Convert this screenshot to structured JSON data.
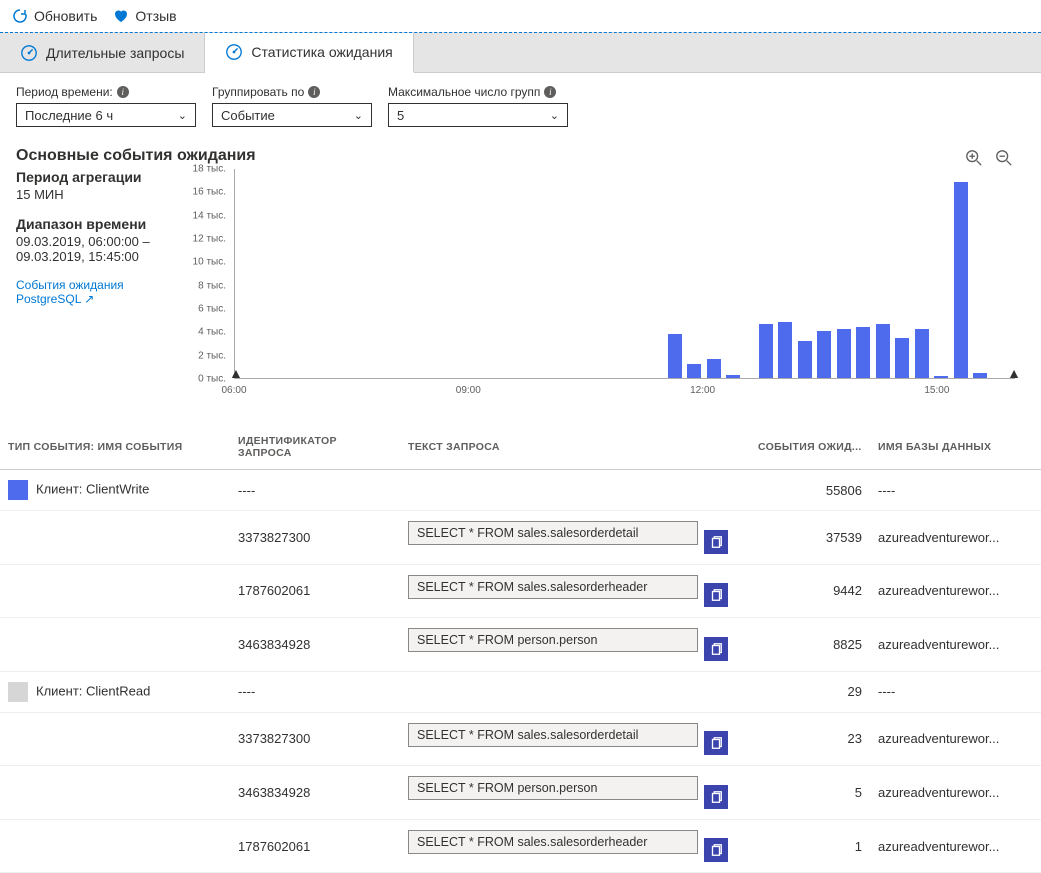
{
  "toolbar": {
    "refresh": "Обновить",
    "feedback": "Отзыв"
  },
  "tabs": {
    "long_queries": "Длительные запросы",
    "wait_stats": "Статистика ожидания"
  },
  "filters": {
    "period_label": "Период времени:",
    "period_value": "Последние 6 ч",
    "group_label": "Группировать по",
    "group_value": "Событие",
    "max_groups_label": "Максимальное число групп",
    "max_groups_value": "5"
  },
  "section_title": "Основные события ожидания",
  "sidebar": {
    "agg_label": "Период агрегации",
    "agg_value": "15 МИН",
    "range_label": "Диапазон времени",
    "range_value": "09.03.2019, 06:00:00 – 09.03.2019, 15:45:00",
    "link": "События ожидания PostgreSQL"
  },
  "chart_data": {
    "type": "bar",
    "ylabel": "тыс.",
    "ylim": [
      0,
      18
    ],
    "y_ticks": [
      0,
      2,
      4,
      6,
      8,
      10,
      12,
      14,
      16,
      18
    ],
    "y_tick_labels": [
      "0 тыс.",
      "2 тыс.",
      "4 тыс.",
      "6 тыс.",
      "8 тыс.",
      "10 тыс.",
      "12 тыс.",
      "14 тыс.",
      "16 тыс.",
      "18 тыс."
    ],
    "x_ticks": [
      "06:00",
      "09:00",
      "12:00",
      "15:00"
    ],
    "x_range_minutes": [
      360,
      960
    ],
    "series": [
      {
        "name": "Клиент: ClientWrite",
        "color": "#4f6bed",
        "points": [
          {
            "t": 693,
            "v": 3.8
          },
          {
            "t": 708,
            "v": 1.2
          },
          {
            "t": 723,
            "v": 1.6
          },
          {
            "t": 738,
            "v": 0.3
          },
          {
            "t": 763,
            "v": 4.6
          },
          {
            "t": 778,
            "v": 4.8
          },
          {
            "t": 793,
            "v": 3.2
          },
          {
            "t": 808,
            "v": 4.0
          },
          {
            "t": 823,
            "v": 4.2
          },
          {
            "t": 838,
            "v": 4.4
          },
          {
            "t": 853,
            "v": 4.6
          },
          {
            "t": 868,
            "v": 3.4
          },
          {
            "t": 883,
            "v": 4.2
          },
          {
            "t": 898,
            "v": 0.2
          },
          {
            "t": 913,
            "v": 16.8
          },
          {
            "t": 928,
            "v": 0.4
          }
        ]
      }
    ]
  },
  "table": {
    "headers": {
      "type": "ТИП СОБЫТИЯ: ИМЯ СОБЫТИЯ",
      "qid": "ИДЕНТИФИКАТОР ЗАПРОСА",
      "qtext": "ТЕКСТ ЗАПРОСА",
      "events": "СОБЫТИЯ ОЖИД...",
      "db": "ИМЯ БАЗЫ ДАННЫХ"
    },
    "groups": [
      {
        "swatch": "sw1",
        "name": "Клиент: ClientWrite",
        "qid": "----",
        "events": 55806,
        "db": "----",
        "rows": [
          {
            "qid": "3373827300",
            "qtext": "SELECT * FROM sales.salesorderdetail",
            "events": 37539,
            "db": "azureadventurewor..."
          },
          {
            "qid": "1787602061",
            "qtext": "SELECT * FROM sales.salesorderheader",
            "events": 9442,
            "db": "azureadventurewor..."
          },
          {
            "qid": "3463834928",
            "qtext": "SELECT * FROM person.person",
            "events": 8825,
            "db": "azureadventurewor..."
          }
        ]
      },
      {
        "swatch": "sw2",
        "name": "Клиент: ClientRead",
        "qid": "----",
        "events": 29,
        "db": "----",
        "rows": [
          {
            "qid": "3373827300",
            "qtext": "SELECT * FROM sales.salesorderdetail",
            "events": 23,
            "db": "azureadventurewor..."
          },
          {
            "qid": "3463834928",
            "qtext": "SELECT * FROM person.person",
            "events": 5,
            "db": "azureadventurewor..."
          },
          {
            "qid": "1787602061",
            "qtext": "SELECT * FROM sales.salesorderheader",
            "events": 1,
            "db": "azureadventurewor..."
          }
        ]
      }
    ]
  }
}
